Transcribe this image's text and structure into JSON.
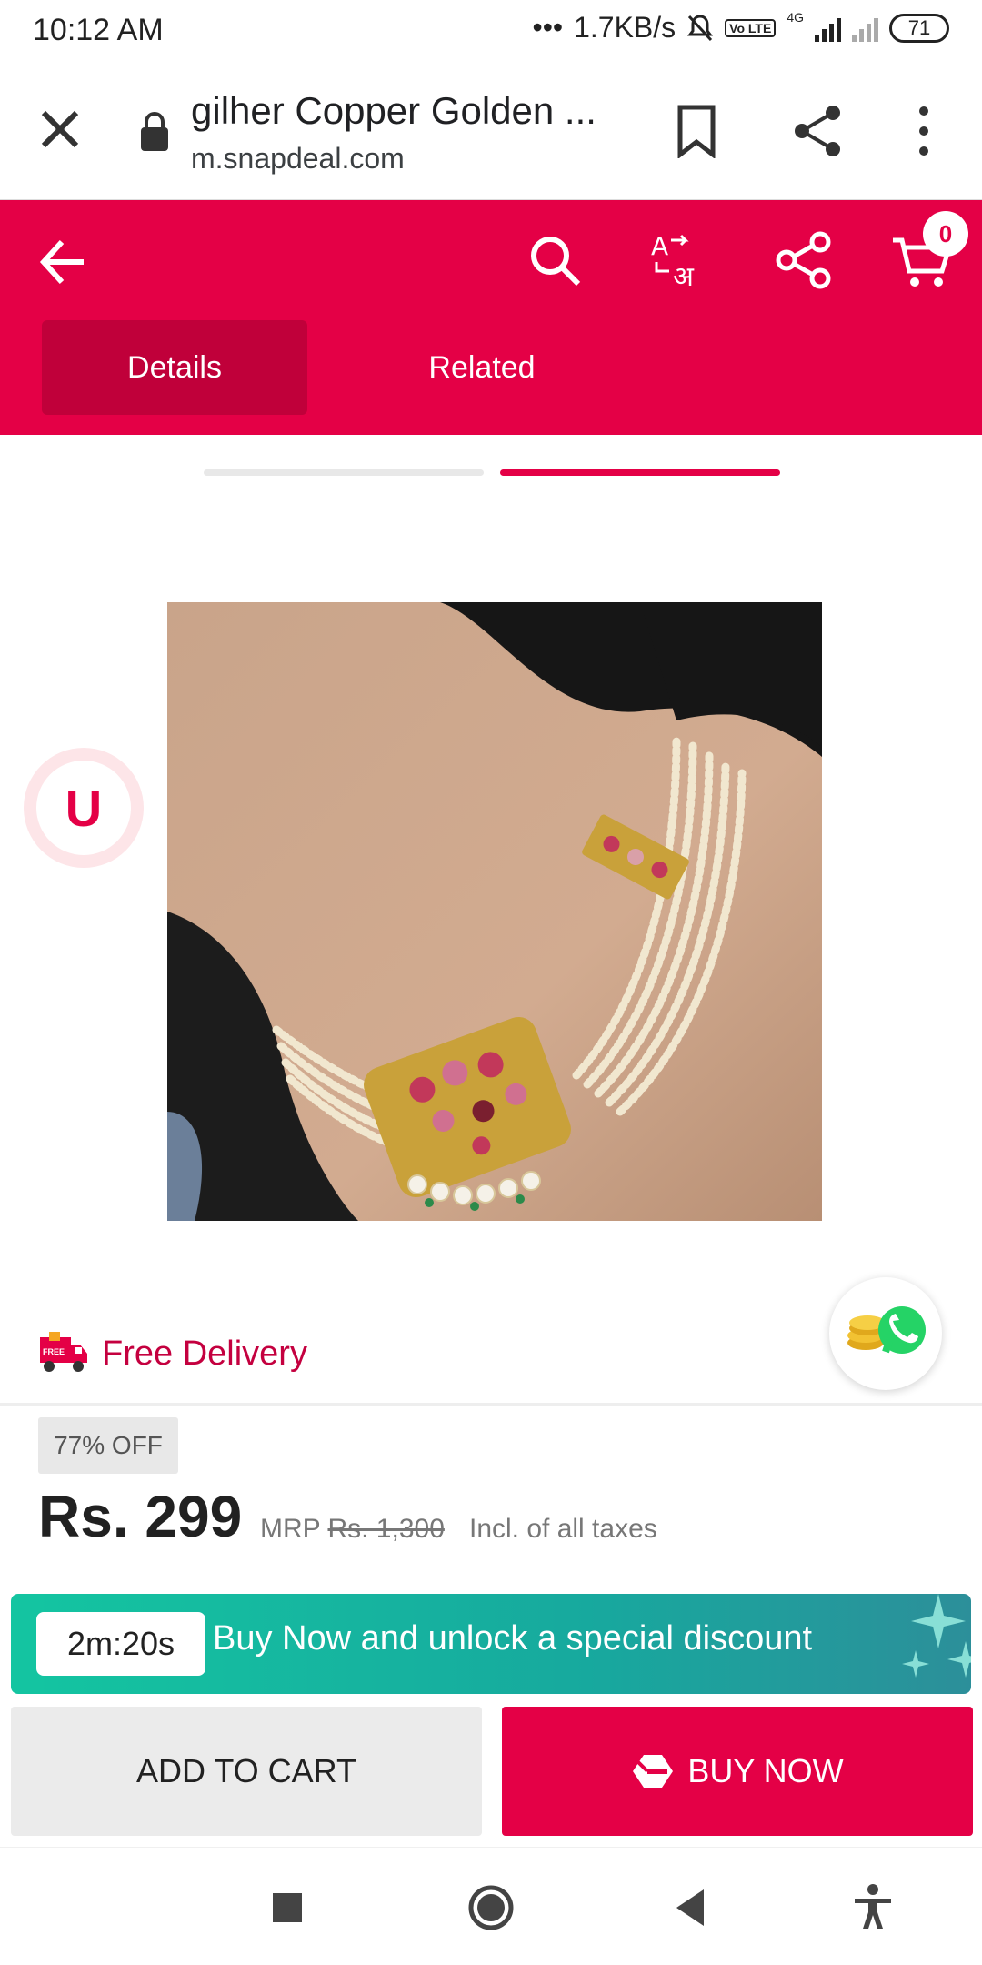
{
  "status": {
    "time": "10:12 AM",
    "net_speed": "1.7KB/s",
    "network": "4G",
    "volte": "Vo LTE",
    "battery": "71"
  },
  "browser": {
    "title": "gilher Copper Golden ...",
    "domain": "m.snapdeal.com"
  },
  "appbar": {
    "cart_count": "0",
    "tabs": [
      {
        "label": "Details"
      },
      {
        "label": "Related"
      }
    ]
  },
  "product": {
    "badge_letter": "U",
    "free_delivery_icon_text": "FREE",
    "free_delivery": "Free Delivery",
    "discount": "77% OFF",
    "price": "Rs. 299",
    "mrp_label": "MRP",
    "mrp_value": "Rs. 1,300",
    "tax_note": "Incl. of all taxes"
  },
  "offer": {
    "timer": "2m:20s",
    "text": "Buy Now and unlock a special discount"
  },
  "actions": {
    "add_to_cart": "ADD TO CART",
    "buy_now": "BUY NOW"
  },
  "colors": {
    "brand": "#e40046",
    "offer_start": "#14c5a1",
    "offer_end": "#2c8f9a"
  }
}
